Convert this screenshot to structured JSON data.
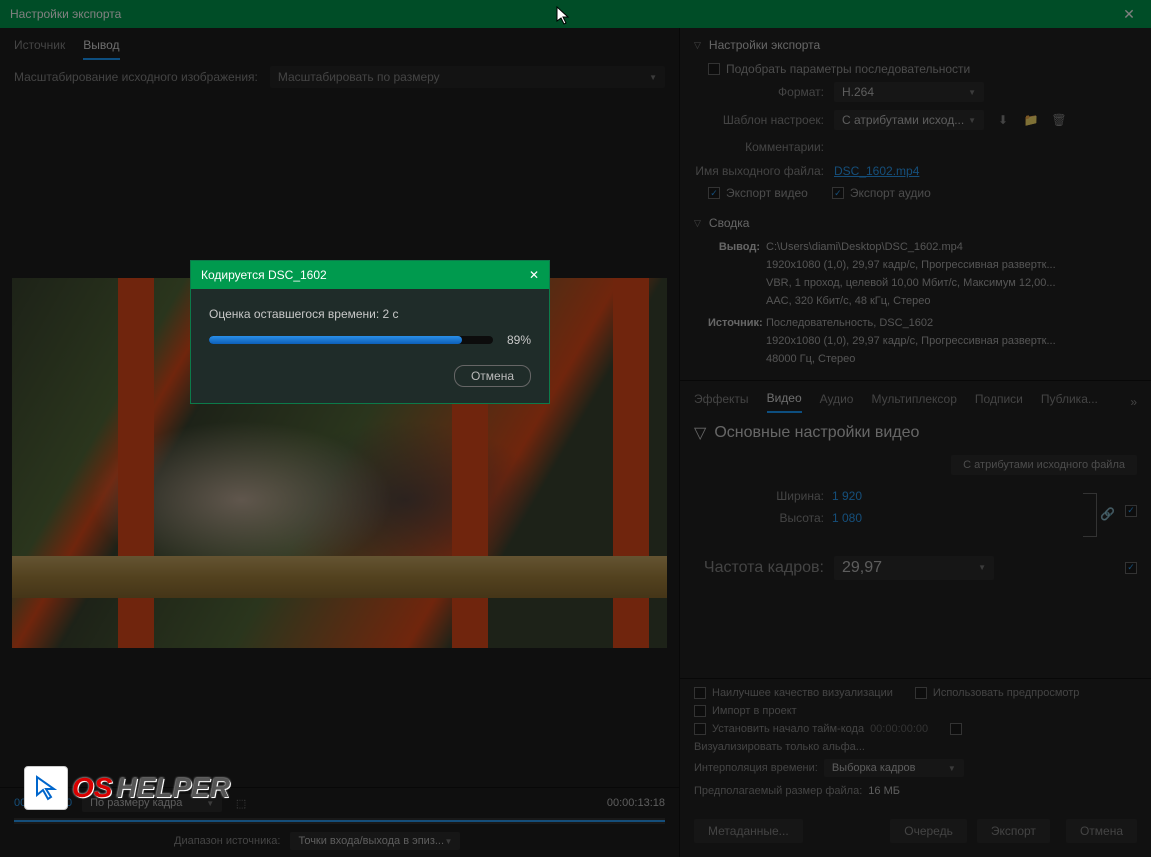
{
  "window": {
    "title": "Настройки экспорта",
    "close": "✕"
  },
  "tabs": {
    "source": "Источник",
    "output": "Вывод"
  },
  "scale": {
    "label": "Масштабирование исходного изображения:",
    "value": "Масштабировать по размеру"
  },
  "progress": {
    "title": "Кодируется DSC_1602",
    "estimate_label": "Оценка оставшегося времени: 2 с",
    "percent": "89%",
    "cancel": "Отмена"
  },
  "timeline": {
    "in": "00:00:00:00",
    "fit": "По размеру кадра",
    "out": "00:00:13:18",
    "range_label": "Диапазон источника:",
    "range_value": "Точки входа/выхода в эпиз..."
  },
  "export": {
    "header": "Настройки экспорта",
    "match_seq": "Подобрать параметры последовательности",
    "format_label": "Формат:",
    "format_value": "H.264",
    "preset_label": "Шаблон настроек:",
    "preset_value": "С атрибутами исход...",
    "comments_label": "Комментарии:",
    "output_name_label": "Имя выходного файла:",
    "output_name_value": "DSC_1602.mp4",
    "export_video": "Экспорт видео",
    "export_audio": "Экспорт аудио"
  },
  "summary": {
    "header": "Сводка",
    "out_label": "Вывод:",
    "out_line1": "C:\\Users\\diami\\Desktop\\DSC_1602.mp4",
    "out_line2": "1920x1080 (1,0), 29,97 кадр/с, Прогрессивная развертк...",
    "out_line3": "VBR, 1 проход, целевой 10,00 Мбит/с, Максимум 12,00...",
    "out_line4": "AAC, 320 Кбит/с, 48 кГц, Стерео",
    "src_label": "Источник:",
    "src_line1": "Последовательность, DSC_1602",
    "src_line2": "1920x1080 (1,0), 29,97 кадр/с, Прогрессивная развертк...",
    "src_line3": "48000 Гц, Стерео"
  },
  "subtabs": {
    "effects": "Эффекты",
    "video": "Видео",
    "audio": "Аудио",
    "mux": "Мультиплексор",
    "captions": "Подписи",
    "publish": "Публика..."
  },
  "video": {
    "header": "Основные настройки видео",
    "match_source": "С атрибутами исходного файла",
    "width_label": "Ширина:",
    "width": "1 920",
    "height_label": "Высота:",
    "height": "1 080",
    "fps_label": "Частота кадров:",
    "fps": "29,97"
  },
  "options": {
    "max_quality": "Наилучшее качество визуализации",
    "use_preview": "Использовать предпросмотр",
    "import_project": "Импорт в проект",
    "start_tc": "Установить начало тайм-кода",
    "tc_value": "00:00:00:00",
    "render_alpha": "Визуализировать только альфа...",
    "interp_label": "Интерполяция времени:",
    "interp_value": "Выборка кадров",
    "size_label": "Предполагаемый размер файла:",
    "size_value": "16 МБ"
  },
  "buttons": {
    "metadata": "Метаданные...",
    "queue": "Очередь",
    "export": "Экспорт",
    "cancel": "Отмена"
  },
  "watermark": {
    "os": "OS",
    "helper": "HELPER"
  }
}
